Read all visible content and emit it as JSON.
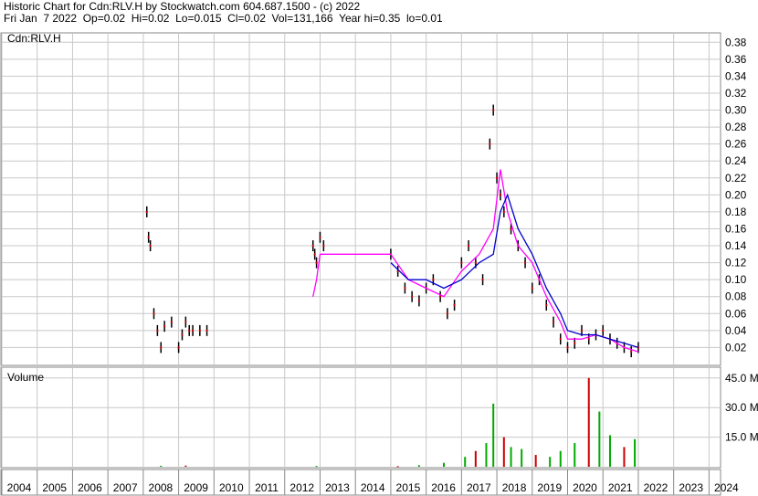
{
  "header": {
    "line1": "Historic Chart for Cdn:RLV.H by Stockwatch.com 604.687.1500 - (c) 2022",
    "line2": "Fri Jan  7 2022  Op=0.02  Hi=0.02  Lo=0.015  Cl=0.02  Vol=131,166  Year hi=0.35  lo=0.01"
  },
  "price_panel_label": "Cdn:RLV.H",
  "volume_panel_label": "Volume",
  "colors": {
    "price_bars": "#000000",
    "ma_short": "#ff00ff",
    "ma_long": "#0000cc",
    "gaps": "#cc0000",
    "volume_up": "#00aa00",
    "volume_down": "#cc0000",
    "grid": "#c8c8c8"
  },
  "chart_data": [
    {
      "type": "line",
      "title": "Cdn:RLV.H",
      "x_ticks": [
        "2004",
        "2005",
        "2006",
        "2007",
        "2008",
        "2009",
        "2010",
        "2011",
        "2012",
        "2013",
        "2014",
        "2015",
        "2016",
        "2017",
        "2018",
        "2019",
        "2020",
        "2021",
        "2022",
        "2023",
        "2024"
      ],
      "y_ticks": [
        "0.38",
        "0.36",
        "0.34",
        "0.32",
        "0.30",
        "0.28",
        "0.26",
        "0.24",
        "0.22",
        "0.20",
        "0.18",
        "0.16",
        "0.14",
        "0.12",
        "0.10",
        "0.08",
        "0.06",
        "0.04",
        "0.02"
      ],
      "ylim": [
        0,
        0.39
      ],
      "xlim": [
        2004,
        2024.3
      ],
      "grid": true,
      "series": [
        {
          "name": "",
          "x": [
            2008.1,
            2008.15,
            2008.2,
            2008.3,
            2008.4,
            2008.5,
            2008.6,
            2008.8,
            2009.0,
            2009.1,
            2009.2,
            2009.3,
            2009.4,
            2009.6,
            2009.8,
            2012.8,
            2012.85,
            2012.9,
            2013.0,
            2013.1,
            2015.0,
            2015.2,
            2015.4,
            2015.6,
            2015.8,
            2016.0,
            2016.2,
            2016.4,
            2016.6,
            2016.8,
            2017.0,
            2017.2,
            2017.4,
            2017.6,
            2017.8,
            2017.9,
            2018.0,
            2018.1,
            2018.2,
            2018.4,
            2018.6,
            2018.8,
            2019.0,
            2019.2,
            2019.4,
            2019.6,
            2019.8,
            2020.0,
            2020.2,
            2020.4,
            2020.6,
            2020.8,
            2021.0,
            2021.2,
            2021.4,
            2021.6,
            2021.8,
            2022.0
          ],
          "y": [
            0.18,
            0.15,
            0.14,
            0.06,
            0.04,
            0.02,
            0.045,
            0.05,
            0.02,
            0.035,
            0.05,
            0.04,
            0.04,
            0.04,
            0.04,
            0.14,
            0.13,
            0.12,
            0.15,
            0.14,
            0.13,
            0.11,
            0.09,
            0.08,
            0.075,
            0.09,
            0.1,
            0.08,
            0.06,
            0.07,
            0.12,
            0.14,
            0.12,
            0.1,
            0.26,
            0.3,
            0.22,
            0.2,
            0.18,
            0.16,
            0.14,
            0.12,
            0.09,
            0.1,
            0.07,
            0.05,
            0.03,
            0.02,
            0.025,
            0.04,
            0.03,
            0.035,
            0.04,
            0.03,
            0.025,
            0.02,
            0.015,
            0.02
          ]
        },
        {
          "name": "",
          "x": [
            2012.8,
            2012.9,
            2013.0,
            2015.0,
            2015.5,
            2016.0,
            2016.5,
            2017.0,
            2017.5,
            2017.9,
            2018.1,
            2018.3,
            2018.6,
            2019.0,
            2019.4,
            2019.8,
            2020.0,
            2020.4,
            2020.8,
            2021.2,
            2021.6,
            2022.0
          ],
          "y": [
            0.08,
            0.1,
            0.13,
            0.13,
            0.1,
            0.09,
            0.08,
            0.11,
            0.13,
            0.16,
            0.23,
            0.18,
            0.14,
            0.12,
            0.08,
            0.05,
            0.03,
            0.03,
            0.035,
            0.03,
            0.02,
            0.015
          ]
        },
        {
          "name": "",
          "x": [
            2015.0,
            2015.5,
            2016.0,
            2016.5,
            2017.0,
            2017.5,
            2017.9,
            2018.1,
            2018.3,
            2018.6,
            2019.0,
            2019.4,
            2019.8,
            2020.0,
            2020.4,
            2020.8,
            2021.2,
            2021.6,
            2022.0
          ],
          "y": [
            0.12,
            0.1,
            0.1,
            0.09,
            0.1,
            0.12,
            0.13,
            0.18,
            0.2,
            0.16,
            0.13,
            0.09,
            0.06,
            0.04,
            0.035,
            0.035,
            0.03,
            0.025,
            0.02
          ]
        }
      ]
    },
    {
      "type": "bar",
      "title": "Volume",
      "unit": "M",
      "y_ticks": [
        "45.0 M",
        "30.0 M",
        "15.0 M"
      ],
      "ylim": [
        0,
        50
      ],
      "grid": true,
      "x": [
        2008.5,
        2009.2,
        2012.9,
        2015.2,
        2015.8,
        2016.5,
        2017.1,
        2017.4,
        2017.7,
        2017.9,
        2018.2,
        2018.4,
        2018.7,
        2019.1,
        2019.5,
        2019.8,
        2020.2,
        2020.6,
        2020.9,
        2021.2,
        2021.6,
        2021.9
      ],
      "values": [
        0.5,
        0.6,
        0.4,
        0.3,
        0.8,
        2.0,
        5.0,
        8.0,
        12.0,
        32.0,
        15.0,
        10.0,
        9.0,
        6.0,
        5.0,
        8.0,
        12.0,
        45.0,
        28.0,
        16.0,
        10.0,
        14.0
      ],
      "up": [
        true,
        false,
        true,
        false,
        true,
        true,
        true,
        false,
        true,
        true,
        false,
        true,
        true,
        false,
        true,
        true,
        true,
        false,
        true,
        true,
        false,
        true
      ]
    }
  ]
}
